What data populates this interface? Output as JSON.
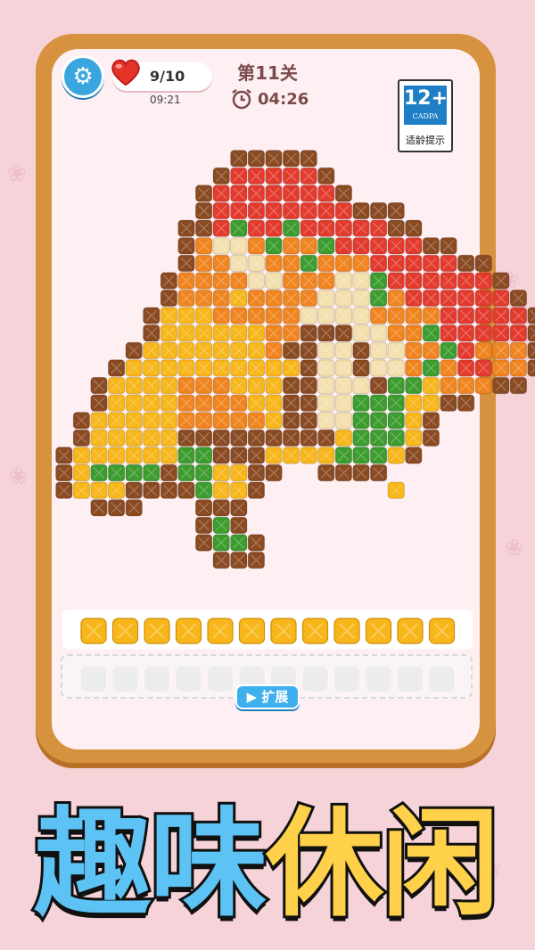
{
  "hud": {
    "lives": "9/10",
    "life_timer": "09:21",
    "level": "第11关",
    "countdown": "04:26",
    "settings_icon": "gear-icon",
    "lives_icon": "heart-icon",
    "timer_icon": "alarm-clock-icon"
  },
  "age_badge": {
    "rating": "12+",
    "org": "CADPA",
    "label": "适龄提示"
  },
  "tray": {
    "tile_count": 12,
    "empty_slots": 12,
    "expand_label": "扩展",
    "expand_icon": "video-icon"
  },
  "banner": {
    "chars": [
      "趣",
      "味",
      "休",
      "闲"
    ]
  },
  "colors": {
    "background": "#f6d3d9",
    "frame": "#d6923e",
    "panel": "#fdeff2",
    "brown": "#8a4a22",
    "red": "#e23b2e",
    "orange": "#f0841f",
    "yellow": "#f7b619",
    "cream": "#f4dfae",
    "green": "#3c9c2e",
    "accent_blue": "#3fb0ee"
  }
}
